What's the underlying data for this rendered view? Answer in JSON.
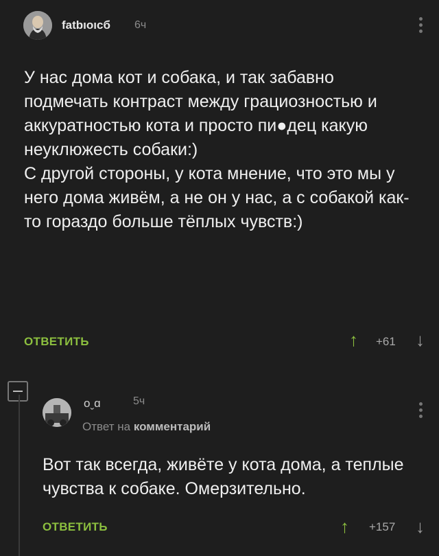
{
  "post": {
    "author": "fatbıoıcб",
    "time": "6ч",
    "body": "У нас дома кот и собака, и так забавно подмечать контраст между грациозностью и аккуратностью кота и просто пи●дец какую неуклюжесть собаки:)\nС другой стороны, у кота мнение, что это мы у него дома живём, а не он у нас, а с собакой как-то гораздо больше тёплых чувств:)",
    "reply_label": "ОТВЕТИТЬ",
    "score": "+61",
    "upvote_icon": "arrow-up-icon",
    "downvote_icon": "arrow-down-icon"
  },
  "reply": {
    "author": "oˬɑ",
    "time": "5ч",
    "meta_prefix": "Ответ на",
    "meta_link": "комментарий",
    "body": "Вот так всегда, живёте у кота дома, а теплые чувства к собаке. Омерзительно.",
    "reply_label": "ОТВЕТИТЬ",
    "score": "+157"
  },
  "colors": {
    "accent": "#8cbf3f",
    "background": "#1e1e1e",
    "text": "#efefef",
    "muted": "#8c8c8c"
  }
}
